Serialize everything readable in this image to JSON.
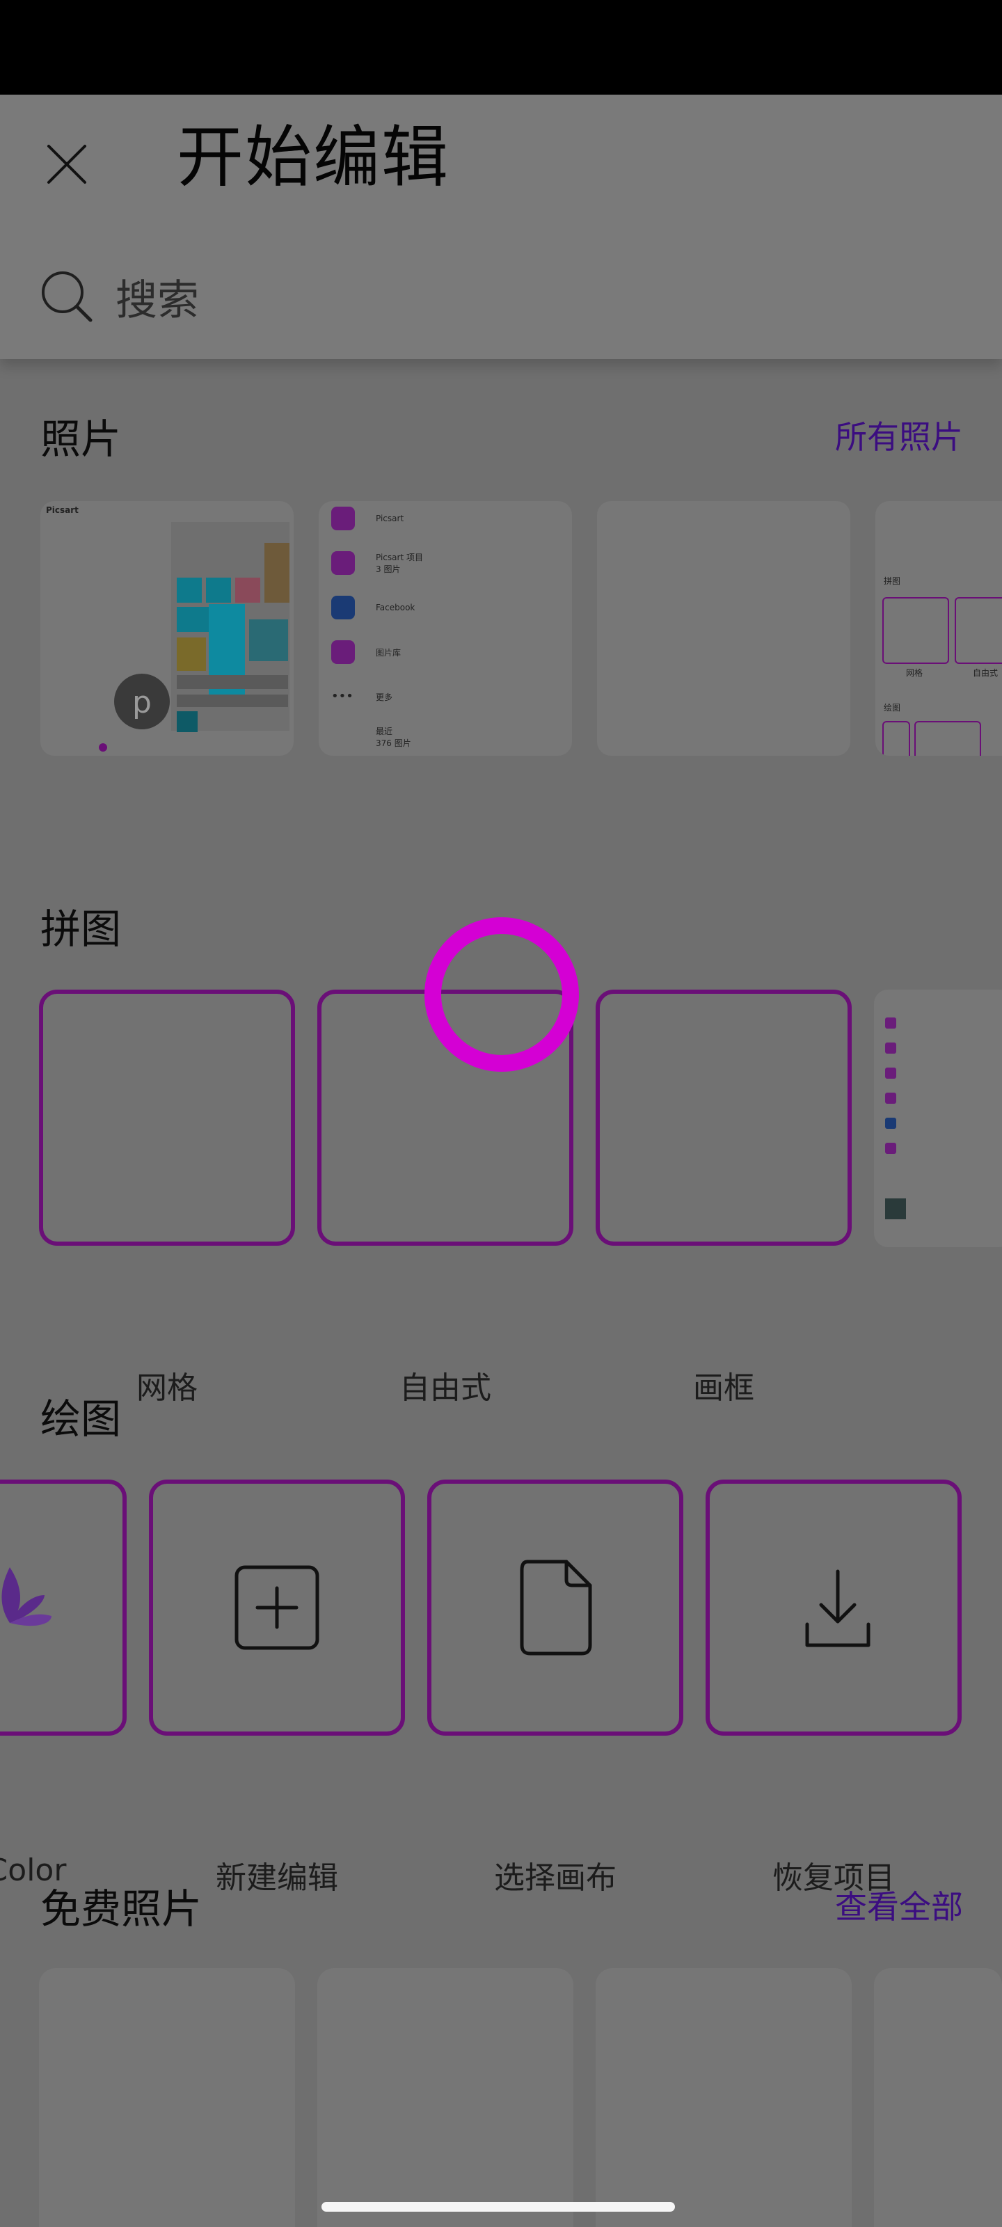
{
  "header": {
    "title": "开始编辑",
    "search_placeholder": "搜索"
  },
  "sections": {
    "photos": {
      "title": "照片",
      "link": "所有照片",
      "thumb2_items": [
        {
          "label": "Picsart",
          "icon": "picsart-icon"
        },
        {
          "label": "Picsart 项目",
          "sub": "3 图片",
          "icon": "folder-icon"
        },
        {
          "label": "Facebook",
          "icon": "facebook-icon"
        },
        {
          "label": "图片库",
          "icon": "gallery-icon"
        },
        {
          "label": "更多",
          "icon": "more-icon"
        },
        {
          "label": "最近",
          "sub": "376 图片"
        }
      ],
      "thumb1_brand": "Picsart",
      "thumb4_labels": {
        "collage": "拼图",
        "grid": "网格",
        "freestyle": "自由式",
        "draw": "绘图"
      }
    },
    "collage": {
      "title": "拼图",
      "items": [
        {
          "label": "网格"
        },
        {
          "label": "自由式"
        },
        {
          "label": "画框"
        }
      ]
    },
    "drawing": {
      "title": "绘图",
      "items": [
        {
          "label": "Color",
          "icon": "lotus-icon"
        },
        {
          "label": "新建编辑",
          "icon": "plus-square-icon"
        },
        {
          "label": "选择画布",
          "icon": "document-icon"
        },
        {
          "label": "恢复项目",
          "icon": "download-icon"
        }
      ]
    },
    "free_photos": {
      "title": "免费照片",
      "link": "查看全部"
    }
  },
  "colors": {
    "accent": "#6a0f77",
    "link": "#3b0d80",
    "touch": "#d400d4"
  }
}
